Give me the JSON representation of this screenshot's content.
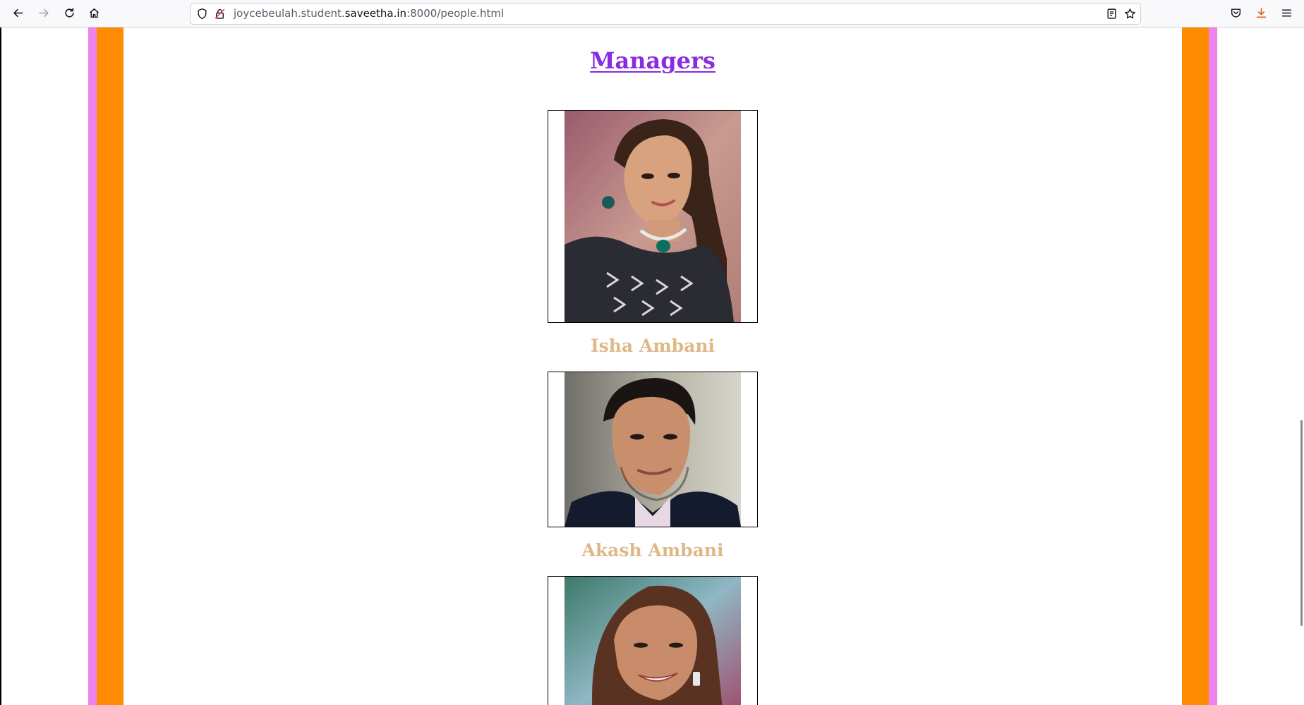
{
  "browser": {
    "url": {
      "prefix": "joycebeulah.student.",
      "domain": "saveetha.in",
      "suffix": ":8000/people.html"
    },
    "icons": [
      "back-icon",
      "forward-icon",
      "reload-icon",
      "home-icon",
      "shield-icon",
      "lock-icon",
      "reader-view-icon",
      "bookmark-star-icon",
      "pocket-icon",
      "download-icon",
      "menu-icon"
    ]
  },
  "page": {
    "section_title": "Managers",
    "people": [
      {
        "name": "Isha Ambani"
      },
      {
        "name": "Akash Ambani"
      },
      {
        "name": ""
      }
    ],
    "colors": {
      "violet": "#ee82ee",
      "orange": "#ff8c00",
      "title": "#8a2be2",
      "name": "#deb887"
    }
  }
}
